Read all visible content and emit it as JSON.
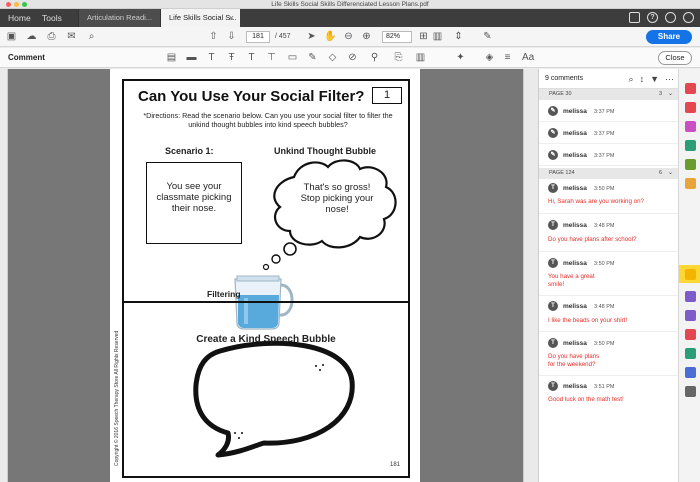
{
  "window": {
    "title": "Life Skills Social Skills Differenciated Lesson Plans.pdf"
  },
  "nav": {
    "home": "Home",
    "tools": "Tools"
  },
  "tabs": [
    {
      "label": "Articulation Readi..."
    },
    {
      "label": "Life Skills Social S..."
    }
  ],
  "toolbar": {
    "page_current": "181",
    "page_total": "/ 457",
    "zoom": "82%",
    "share_label": "Share"
  },
  "comment_bar": {
    "label": "Comment",
    "close_label": "Close"
  },
  "worksheet": {
    "title": "Can You Use Your Social Filter?",
    "number": "1",
    "directions": "*Directions: Read the scenario below. Can you use your social filter to filter the unkind thought bubbles into kind speech bubbles?",
    "scenario_title": "Scenario 1:",
    "unkind_title": "Unkind Thought Bubble",
    "scenario_text": "You see your classmate picking their nose.",
    "unkind_text": "That's so gross! Stop picking your nose!",
    "filtering_label": "Filtering",
    "kind_title": "Create a Kind Speech Bubble",
    "copyright": "Copyright © 2016 Speech Therapy Store All Rights Reserved",
    "page_number": "181"
  },
  "comments_panel": {
    "count_label": "9 comments",
    "groups": [
      {
        "label": "PAGE 30",
        "count": "3",
        "comments": [
          {
            "user": "melissa",
            "time": "3:37 PM",
            "text": ""
          },
          {
            "user": "melissa",
            "time": "3:37 PM",
            "text": ""
          },
          {
            "user": "melissa",
            "time": "3:37 PM",
            "text": ""
          }
        ]
      },
      {
        "label": "PAGE 124",
        "count": "6",
        "comments": [
          {
            "user": "melissa",
            "time": "3:50 PM",
            "text": "Hi, Sarah was are you working on?"
          },
          {
            "user": "melissa",
            "time": "3:48 PM",
            "text": "Do you have plans after school?"
          },
          {
            "user": "melissa",
            "time": "3:50 PM",
            "text": "You have a great\nsmile!"
          },
          {
            "user": "melissa",
            "time": "3:48 PM",
            "text": "I like the beads on your shirt!"
          },
          {
            "user": "melissa",
            "time": "3:50 PM",
            "text": "Do you have plans\nfor the weekend?"
          },
          {
            "user": "melissa",
            "time": "3:51 PM",
            "text": "Good luck on the math test!"
          }
        ]
      }
    ]
  },
  "colors": {
    "accent": "#1473e6",
    "comment_text": "#e8302a",
    "rail_active": "#fdd835"
  }
}
